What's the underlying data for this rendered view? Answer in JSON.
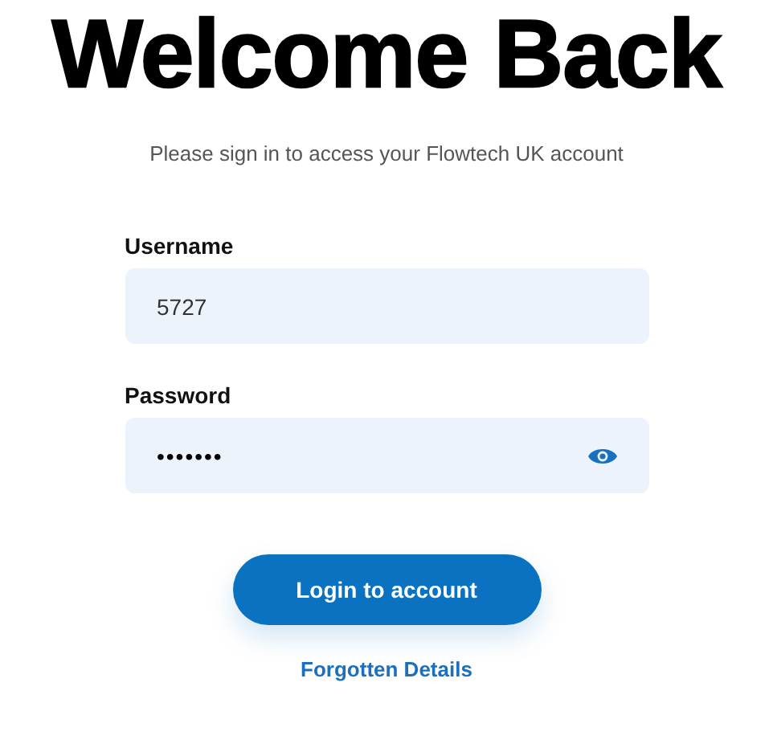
{
  "title": "Welcome Back",
  "subtitle": "Please sign in to access your Flowtech UK account",
  "fields": [
    {
      "label": "Username",
      "value": "5727",
      "kind": "text"
    },
    {
      "label": "Password",
      "value": "•••••••",
      "kind": "password"
    }
  ],
  "login_button": "Login to account",
  "forgot_link": "Forgotten Details"
}
